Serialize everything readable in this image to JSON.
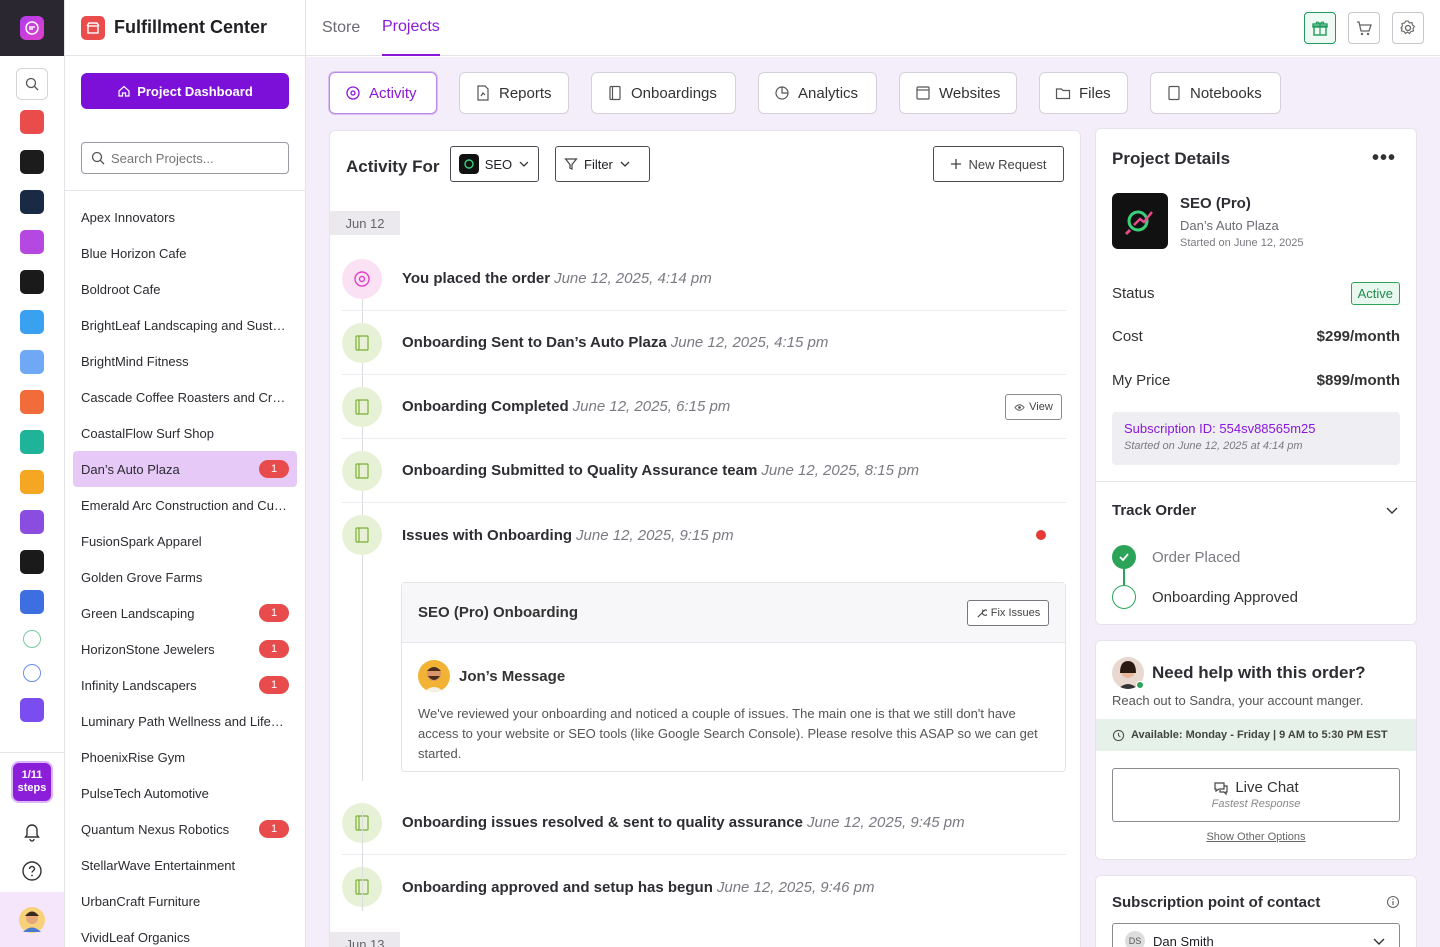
{
  "rail": {
    "steps": "1/11 steps",
    "app_colors": [
      "#ea4b4b",
      "#1c1c1c",
      "#1a2a44",
      "#b548e0",
      "#1a1a1a",
      "#3aa0f0",
      "#6fa8f5",
      "#f26b3a",
      "#1fb39a",
      "#f5a623",
      "#8a4de0",
      "#1a1a1a",
      "#3d6fe0",
      "#7cc9a0",
      "#6a8cf0",
      "#7a4df0"
    ]
  },
  "sidebar": {
    "title": "Fulfillment Center",
    "dashboard_button": "Project Dashboard",
    "search_placeholder": "Search Projects...",
    "projects": [
      {
        "name": "Apex Innovators",
        "badge": ""
      },
      {
        "name": "Blue Horizon Cafe",
        "badge": ""
      },
      {
        "name": "Boldroot Cafe",
        "badge": ""
      },
      {
        "name": "BrightLeaf Landscaping and Sust…",
        "badge": ""
      },
      {
        "name": "BrightMind Fitness",
        "badge": ""
      },
      {
        "name": "Cascade Coffee Roasters and Cra…",
        "badge": ""
      },
      {
        "name": "CoastalFlow Surf Shop",
        "badge": ""
      },
      {
        "name": "Dan’s Auto Plaza",
        "badge": "1",
        "active": true
      },
      {
        "name": "Emerald Arc Construction and Cu…",
        "badge": ""
      },
      {
        "name": "FusionSpark Apparel",
        "badge": ""
      },
      {
        "name": "Golden Grove Farms",
        "badge": ""
      },
      {
        "name": "Green Landscaping",
        "badge": "1"
      },
      {
        "name": "HorizonStone Jewelers",
        "badge": "1"
      },
      {
        "name": "Infinity Landscapers",
        "badge": "1"
      },
      {
        "name": "Luminary Path Wellness and Life…",
        "badge": ""
      },
      {
        "name": "PhoenixRise Gym",
        "badge": ""
      },
      {
        "name": "PulseTech Automotive",
        "badge": ""
      },
      {
        "name": "Quantum Nexus Robotics",
        "badge": "1"
      },
      {
        "name": "StellarWave Entertainment",
        "badge": ""
      },
      {
        "name": "UrbanCraft Furniture",
        "badge": ""
      },
      {
        "name": "VividLeaf Organics",
        "badge": ""
      }
    ]
  },
  "topnav": {
    "store": "Store",
    "projects": "Projects"
  },
  "tabs": [
    "Activity",
    "Reports",
    "Onboardings",
    "Analytics",
    "Websites",
    "Files",
    "Notebooks"
  ],
  "feed": {
    "title": "Activity For",
    "service": "SEO",
    "filter": "Filter",
    "new_request": "New Request",
    "date1": "Jun 12",
    "date2": "Jun 13",
    "events": [
      {
        "text": "You placed the order",
        "time": "June 12, 2025, 4:14 pm"
      },
      {
        "text": "Onboarding Sent to Dan’s Auto Plaza",
        "time": "June 12, 2025, 4:15 pm"
      },
      {
        "text": "Onboarding Completed",
        "time": "June 12, 2025, 6:15 pm"
      },
      {
        "text": "Onboarding Submitted to Quality Assurance team",
        "time": "June 12, 2025, 8:15 pm"
      },
      {
        "text": "Issues with Onboarding",
        "time": "June 12, 2025, 9:15 pm"
      },
      {
        "text": "Onboarding issues resolved & sent to quality assurance",
        "time": "June 12, 2025, 9:45 pm"
      },
      {
        "text": "Onboarding approved and setup has begun",
        "time": "June 12, 2025, 9:46 pm"
      }
    ],
    "view_label": "View",
    "issue": {
      "title": "SEO (Pro) Onboarding",
      "fix_label": "Fix Issues",
      "author": "Jon’s Message",
      "message": "We've reviewed your onboarding and noticed a couple of issues. The main one is that we still don't have access to your website or SEO tools (like Google Search Console). Please resolve this ASAP so we can get started."
    }
  },
  "details": {
    "title": "Project Details",
    "more": "•••",
    "name": "SEO (Pro)",
    "client": "Dan’s Auto Plaza",
    "started": "Started on June 12, 2025",
    "status_label": "Status",
    "status_value": "Active",
    "cost_label": "Cost",
    "cost_value": "$299/month",
    "price_label": "My Price",
    "price_value": "$899/month",
    "subscription_id": "Subscription ID: 554sv88565m25",
    "subscription_started": "Started on June 12, 2025 at 4:14 pm",
    "track_title": "Track Order",
    "step1": "Order Placed",
    "step2": "Onboarding Approved"
  },
  "help": {
    "title": "Need help with this order?",
    "subtitle": "Reach out to Sandra, your account manger.",
    "availability": "Available: Monday - Friday | 9 AM to 5:30 PM EST",
    "live_chat": "Live Chat",
    "live_sub": "Fastest Response",
    "other": "Show Other Options"
  },
  "contact": {
    "title": "Subscription point of contact",
    "initials": "DS",
    "name": "Dan Smith"
  }
}
